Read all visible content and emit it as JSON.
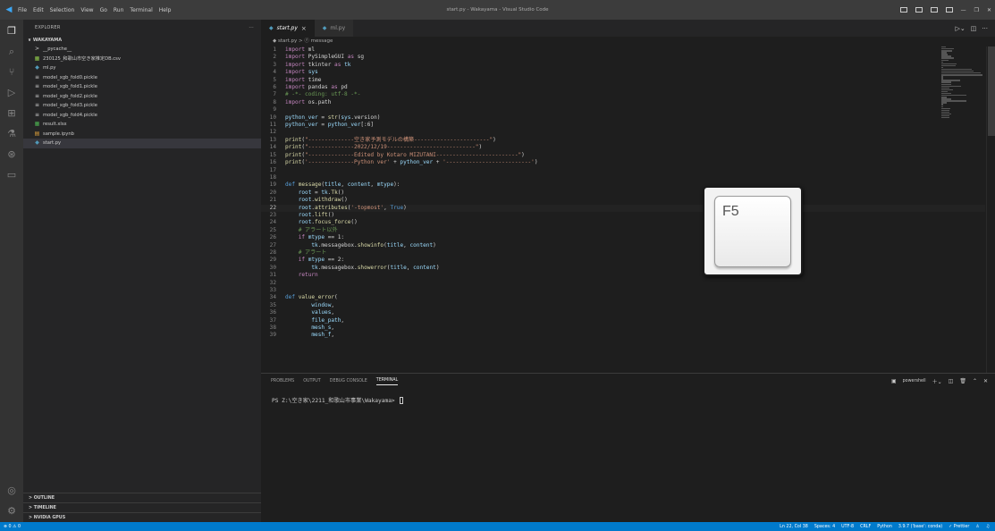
{
  "titlebar": {
    "menu": [
      "File",
      "Edit",
      "Selection",
      "View",
      "Go",
      "Run",
      "Terminal",
      "Help"
    ],
    "title": "start.py - Wakayama - Visual Studio Code"
  },
  "explorer": {
    "header": "EXPLORER",
    "more": "···",
    "root": "WAKAYAMA",
    "items": [
      {
        "icon": ">",
        "label": "__pycache__",
        "color": "#cccccc"
      },
      {
        "icon": "▦",
        "label": "230125_和歌山市空き家推定DB.csv",
        "color": "#8bc34a"
      },
      {
        "icon": "◆",
        "label": "ml.py",
        "color": "#519aba"
      },
      {
        "icon": "≡",
        "label": "model_xgb_fold0.pickle",
        "color": "#cccccc"
      },
      {
        "icon": "≡",
        "label": "model_xgb_fold1.pickle",
        "color": "#cccccc"
      },
      {
        "icon": "≡",
        "label": "model_xgb_fold2.pickle",
        "color": "#cccccc"
      },
      {
        "icon": "≡",
        "label": "model_xgb_fold3.pickle",
        "color": "#cccccc"
      },
      {
        "icon": "≡",
        "label": "model_xgb_fold4.pickle",
        "color": "#cccccc"
      },
      {
        "icon": "▦",
        "label": "result.xlsx",
        "color": "#4caf50"
      },
      {
        "icon": "▤",
        "label": "sample.ipynb",
        "color": "#e2a33a"
      },
      {
        "icon": "◆",
        "label": "start.py",
        "color": "#519aba"
      }
    ],
    "sections": [
      "> OUTLINE",
      "> TIMELINE",
      "> NVIDIA GPUS"
    ]
  },
  "tabs": [
    {
      "label": "start.py",
      "close": "×",
      "active": true
    },
    {
      "label": "ml.py",
      "close": "",
      "active": false
    }
  ],
  "breadcrumb": "◆ start.py > ⓕ message",
  "code": [
    {
      "n": "1",
      "t": "import ml"
    },
    {
      "n": "2",
      "t": "import PySimpleGUI as sg"
    },
    {
      "n": "3",
      "t": "import tkinter as tk"
    },
    {
      "n": "4",
      "t": "import sys"
    },
    {
      "n": "5",
      "t": "import time"
    },
    {
      "n": "6",
      "t": "import pandas as pd"
    },
    {
      "n": "7",
      "t": "# -*- coding: utf-8 -*-"
    },
    {
      "n": "8",
      "t": "import os.path"
    },
    {
      "n": "9",
      "t": ""
    },
    {
      "n": "10",
      "t": "python_ver = str(sys.version)"
    },
    {
      "n": "11",
      "t": "python_ver = python_ver[:6]"
    },
    {
      "n": "12",
      "t": ""
    },
    {
      "n": "13",
      "t": "print(\"--------------空き家予測モデルの構築-----------------------\")"
    },
    {
      "n": "14",
      "t": "print(\"--------------2022/12/19---------------------------\")"
    },
    {
      "n": "15",
      "t": "print(\"--------------Edited by Kotaro MIZUTANI-------------------------\")"
    },
    {
      "n": "16",
      "t": "print('--------------Python ver' + python_ver + '--------------------------')"
    },
    {
      "n": "17",
      "t": ""
    },
    {
      "n": "18",
      "t": ""
    },
    {
      "n": "19",
      "t": "def message(title, content, mtype):"
    },
    {
      "n": "20",
      "t": "    root = tk.Tk()"
    },
    {
      "n": "21",
      "t": "    root.withdraw()"
    },
    {
      "n": "22",
      "t": "    root.attributes('-topmost', True)"
    },
    {
      "n": "23",
      "t": "    root.lift()"
    },
    {
      "n": "24",
      "t": "    root.focus_force()"
    },
    {
      "n": "25",
      "t": "    # アラート以外"
    },
    {
      "n": "26",
      "t": "    if mtype == 1:"
    },
    {
      "n": "27",
      "t": "        tk.messagebox.showinfo(title, content)"
    },
    {
      "n": "28",
      "t": "    # アラート"
    },
    {
      "n": "29",
      "t": "    if mtype == 2:"
    },
    {
      "n": "30",
      "t": "        tk.messagebox.showerror(title, content)"
    },
    {
      "n": "31",
      "t": "    return"
    },
    {
      "n": "32",
      "t": ""
    },
    {
      "n": "33",
      "t": ""
    },
    {
      "n": "34",
      "t": "def value_error("
    },
    {
      "n": "35",
      "t": "        window,"
    },
    {
      "n": "36",
      "t": "        values,"
    },
    {
      "n": "37",
      "t": "        file_path,"
    },
    {
      "n": "38",
      "t": "        mesh_s,"
    },
    {
      "n": "39",
      "t": "        mesh_f,"
    }
  ],
  "overlay": {
    "key_label": "F5"
  },
  "panel": {
    "tabs": [
      "PROBLEMS",
      "OUTPUT",
      "DEBUG CONSOLE",
      "TERMINAL"
    ],
    "active_tab": "TERMINAL",
    "shell": "powershell",
    "prompt": "PS Z:\\空き家\\2211_和歌山市事業\\Wakayama> "
  },
  "statusbar": {
    "left": "⊗ 0 ⚠ 0",
    "right": [
      "Ln 22, Col 38",
      "Spaces: 4",
      "UTF-8",
      "CRLF",
      "Python",
      "3.9.7 ('base': conda)",
      "✓ Prettier"
    ]
  },
  "colors": {
    "keyword": "#c586c0",
    "def": "#569cd6",
    "function": "#dcdcaa",
    "string": "#ce9178",
    "comment": "#6a9955",
    "variable": "#9cdcfe",
    "accent": "#007acc"
  }
}
